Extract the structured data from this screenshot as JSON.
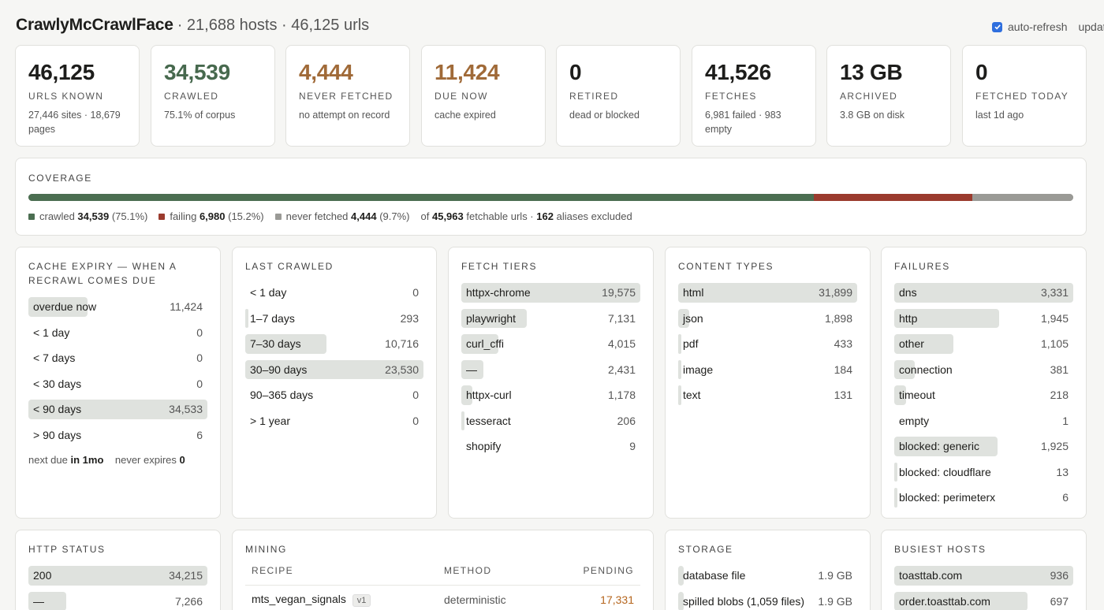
{
  "header": {
    "app_name": "CrawlyMcCrawlFace",
    "subtitle": "· 21,688 hosts · 46,125 urls",
    "auto_refresh_label": "auto-refresh",
    "auto_refresh_checked": true,
    "update_label": "updat"
  },
  "stats": [
    {
      "value": "46,125",
      "label": "URLS KNOWN",
      "sub": "27,446 sites · 18,679 pages"
    },
    {
      "value": "34,539",
      "label": "CRAWLED",
      "sub": "75.1% of corpus"
    },
    {
      "value": "4,444",
      "label": "NEVER FETCHED",
      "sub": "no attempt on record"
    },
    {
      "value": "11,424",
      "label": "DUE NOW",
      "sub": "cache expired"
    },
    {
      "value": "0",
      "label": "RETIRED",
      "sub": "dead or blocked"
    },
    {
      "value": "41,526",
      "label": "FETCHES",
      "sub": "6,981 failed · 983 empty"
    },
    {
      "value": "13 GB",
      "label": "ARCHIVED",
      "sub": "3.8 GB on disk"
    },
    {
      "value": "0",
      "label": "FETCHED TODAY",
      "sub": "last 1d ago"
    }
  ],
  "coverage": {
    "title": "COVERAGE",
    "segments": [
      {
        "name": "crawled",
        "value": 34539,
        "color": "#4b6e51"
      },
      {
        "name": "failing",
        "value": 6980,
        "color": "#9b3b2e"
      },
      {
        "name": "never fetched",
        "value": 4444,
        "color": "#9a9a96"
      }
    ],
    "legend": [
      {
        "label": "crawled",
        "count": "34,539",
        "pct": "(75.1%)",
        "color": "#4b6e51"
      },
      {
        "label": "failing",
        "count": "6,980",
        "pct": "(15.2%)",
        "color": "#9b3b2e"
      },
      {
        "label": "never fetched",
        "count": "4,444",
        "pct": "(9.7%)",
        "color": "#9a9a96"
      }
    ],
    "summary_of": "of",
    "fetchable": "45,963",
    "fetchable_label": "fetchable urls ·",
    "aliases": "162",
    "aliases_label": "aliases excluded"
  },
  "cache_expiry": {
    "title": "CACHE EXPIRY — WHEN A RECRAWL COMES DUE",
    "rows": [
      {
        "label": "overdue now",
        "value": "11,424",
        "frac": 0.33
      },
      {
        "label": "< 1 day",
        "value": "0",
        "frac": 0
      },
      {
        "label": "< 7 days",
        "value": "0",
        "frac": 0
      },
      {
        "label": "< 30 days",
        "value": "0",
        "frac": 0
      },
      {
        "label": "< 90 days",
        "value": "34,533",
        "frac": 1.0
      },
      {
        "label": "> 90 days",
        "value": "6",
        "frac": 0
      }
    ],
    "next_due_label": "next due",
    "next_due": "in 1mo",
    "never_expires_label": "never expires",
    "never_expires": "0"
  },
  "last_crawled": {
    "title": "LAST CRAWLED",
    "rows": [
      {
        "label": "< 1 day",
        "value": "0",
        "frac": 0
      },
      {
        "label": "1–7 days",
        "value": "293",
        "frac": 0.012
      },
      {
        "label": "7–30 days",
        "value": "10,716",
        "frac": 0.455
      },
      {
        "label": "30–90 days",
        "value": "23,530",
        "frac": 1.0
      },
      {
        "label": "90–365 days",
        "value": "0",
        "frac": 0
      },
      {
        "label": "> 1 year",
        "value": "0",
        "frac": 0
      }
    ]
  },
  "fetch_tiers": {
    "title": "FETCH TIERS",
    "rows": [
      {
        "label": "httpx-chrome",
        "value": "19,575",
        "frac": 1.0
      },
      {
        "label": "playwright",
        "value": "7,131",
        "frac": 0.364
      },
      {
        "label": "curl_cffi",
        "value": "4,015",
        "frac": 0.205
      },
      {
        "label": "—",
        "value": "2,431",
        "frac": 0.124
      },
      {
        "label": "httpx-curl",
        "value": "1,178",
        "frac": 0.06
      },
      {
        "label": "tesseract",
        "value": "206",
        "frac": 0.011
      },
      {
        "label": "shopify",
        "value": "9",
        "frac": 0
      }
    ]
  },
  "content_types": {
    "title": "CONTENT TYPES",
    "rows": [
      {
        "label": "html",
        "value": "31,899",
        "frac": 1.0
      },
      {
        "label": "json",
        "value": "1,898",
        "frac": 0.06
      },
      {
        "label": "pdf",
        "value": "433",
        "frac": 0.014
      },
      {
        "label": "image",
        "value": "184",
        "frac": 0.006
      },
      {
        "label": "text",
        "value": "131",
        "frac": 0.004
      }
    ]
  },
  "failures": {
    "title": "FAILURES",
    "rows": [
      {
        "label": "dns",
        "value": "3,331",
        "frac": 1.0
      },
      {
        "label": "http",
        "value": "1,945",
        "frac": 0.584
      },
      {
        "label": "other",
        "value": "1,105",
        "frac": 0.332
      },
      {
        "label": "connection",
        "value": "381",
        "frac": 0.114
      },
      {
        "label": "timeout",
        "value": "218",
        "frac": 0.065
      },
      {
        "label": "empty",
        "value": "1",
        "frac": 0
      },
      {
        "label": "blocked: generic",
        "value": "1,925",
        "frac": 0.578
      },
      {
        "label": "blocked: cloudflare",
        "value": "13",
        "frac": 0.004
      },
      {
        "label": "blocked: perimeterx",
        "value": "6",
        "frac": 0.002
      }
    ]
  },
  "http_status": {
    "title": "HTTP STATUS",
    "rows": [
      {
        "label": "200",
        "value": "34,215",
        "frac": 1.0
      },
      {
        "label": "—",
        "value": "7,266",
        "frac": 0.212
      }
    ]
  },
  "mining": {
    "title": "MINING",
    "col_recipe": "RECIPE",
    "col_method": "METHOD",
    "col_pending": "PENDING",
    "rows": [
      {
        "recipe": "mts_vegan_signals",
        "version": "v1",
        "method": "deterministic",
        "pending": "17,331"
      }
    ]
  },
  "storage": {
    "title": "STORAGE",
    "rows": [
      {
        "label": "database file",
        "value": "1.9 GB",
        "frac": 0.03
      },
      {
        "label": "spilled blobs (1,059 files)",
        "value": "1.9 GB",
        "frac": 0.03
      }
    ]
  },
  "busiest_hosts": {
    "title": "BUSIEST HOSTS",
    "rows": [
      {
        "label": "toasttab.com",
        "value": "936",
        "frac": 1.0
      },
      {
        "label": "order.toasttab.com",
        "value": "697",
        "frac": 0.745
      }
    ]
  }
}
